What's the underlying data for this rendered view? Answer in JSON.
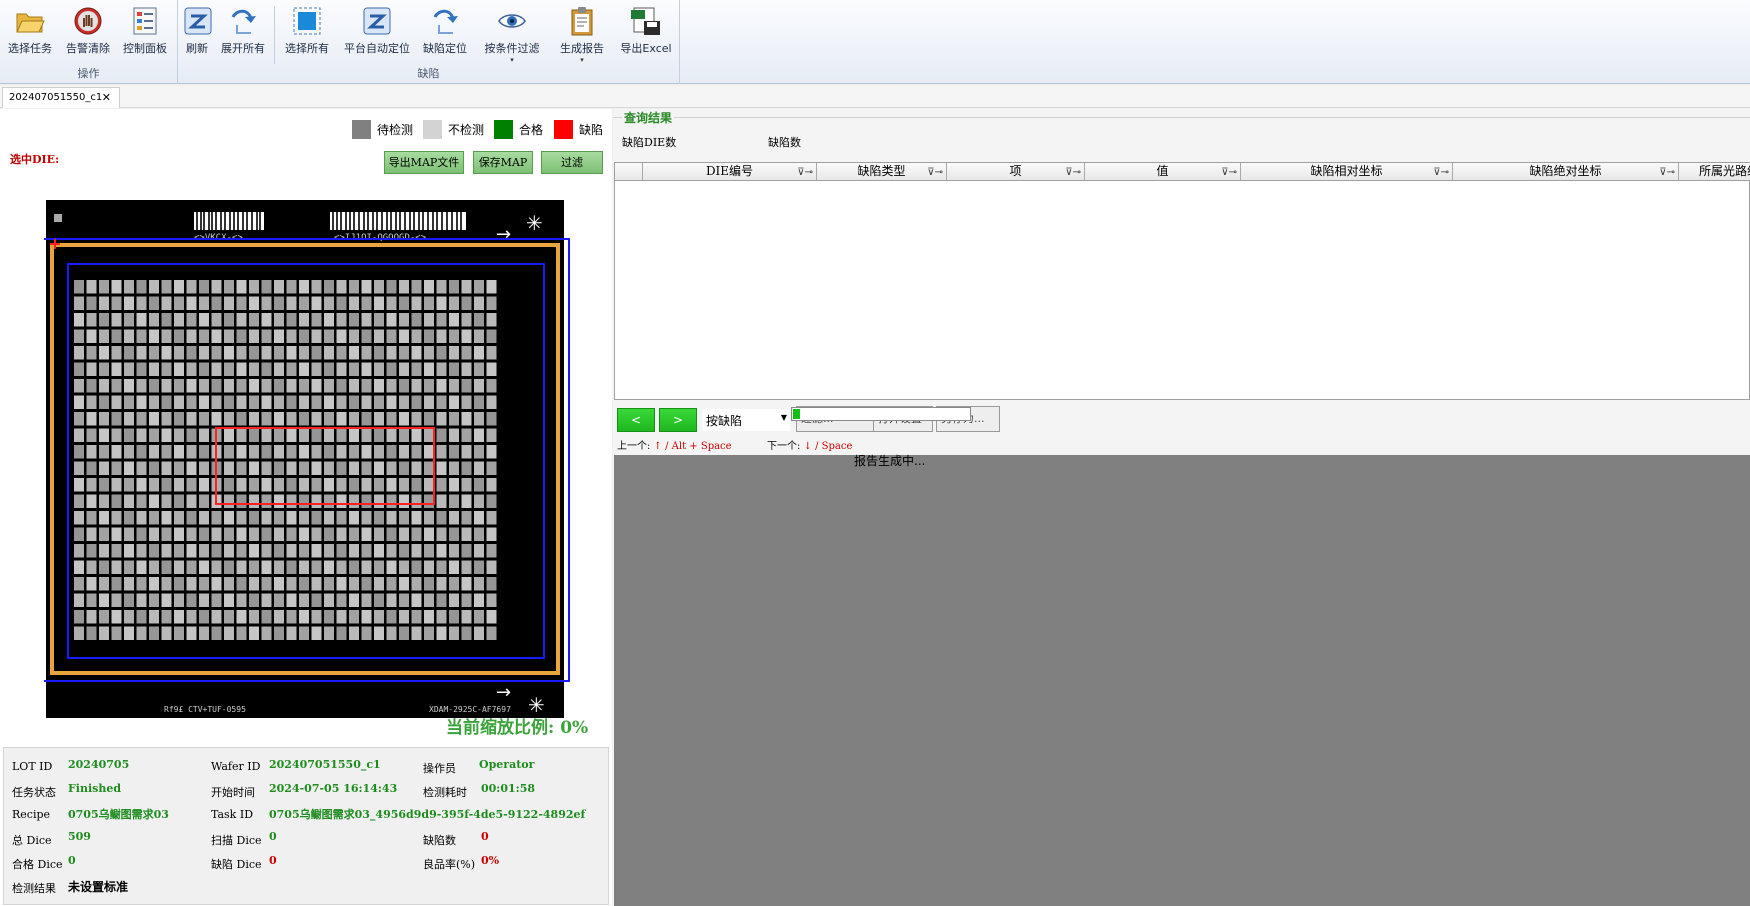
{
  "ribbon": {
    "groups": [
      {
        "label": "操作"
      },
      {
        "label": "缺陷"
      }
    ],
    "buttons": [
      {
        "label": "选择任务"
      },
      {
        "label": "告警清除"
      },
      {
        "label": "控制面板"
      },
      {
        "label": "刷新"
      },
      {
        "label": "展开所有"
      },
      {
        "label": "选择所有"
      },
      {
        "label": "平台自动定位"
      },
      {
        "label": "缺陷定位"
      },
      {
        "label": "按条件过滤",
        "dropdown": "▾"
      },
      {
        "label": "生成报告",
        "dropdown": "▾"
      },
      {
        "label": "导出Excel"
      }
    ]
  },
  "tab": {
    "title": "202407051550_c1",
    "close": "✕"
  },
  "legend": [
    {
      "label": "待检测",
      "color": "#808080"
    },
    {
      "label": "不检测",
      "color": "#d3d3d3"
    },
    {
      "label": "合格",
      "color": "#008000"
    },
    {
      "label": "缺陷",
      "color": "#ff0000"
    }
  ],
  "left": {
    "selected_die_label": "选中DIE:",
    "buttons": {
      "export_map": "导出MAP文件",
      "save_map": "保存MAP",
      "filter": "过滤"
    },
    "zoom_text": "当前缩放比例: 0%",
    "wafer": {
      "top_text_left": "<>VKCX-<>",
      "top_text_right": "<>IJ1OI-QGOOGD-<>",
      "bottom_text_left": "Rf9£ CTV+TUF-0595",
      "bottom_text_right": "XDAM-2925C-AF7697"
    }
  },
  "info": {
    "lot_id": {
      "label": "LOT ID",
      "value": "20240705"
    },
    "wafer_id": {
      "label": "Wafer ID",
      "value": "202407051550_c1"
    },
    "operator": {
      "label": "操作员",
      "value": "Operator"
    },
    "task_status": {
      "label": "任务状态",
      "value": "Finished"
    },
    "start_time": {
      "label": "开始时间",
      "value": "2024-07-05 16:14:43"
    },
    "duration": {
      "label": "检测耗时",
      "value": "00:01:58"
    },
    "recipe": {
      "label": "Recipe",
      "value": "0705乌鳚图需求03"
    },
    "task_id": {
      "label": "Task ID",
      "value": "0705乌鳚图需求03_4956d9d9-395f-4de5-9122-4892ef"
    },
    "total_dice": {
      "label": "总 Dice",
      "value": "509"
    },
    "scan_dice": {
      "label": "扫描 Dice",
      "value": "0"
    },
    "defect_count": {
      "label": "缺陷数",
      "value": "0"
    },
    "pass_dice": {
      "label": "合格 Dice",
      "value": "0"
    },
    "defect_dice": {
      "label": "缺陷 Dice",
      "value": "0"
    },
    "yield": {
      "label": "良品率(%)",
      "value": "0%"
    },
    "result": {
      "label": "检测结果",
      "value": "未设置标准"
    }
  },
  "right": {
    "query_title": "查询结果",
    "defect_die_count_label": "缺陷DIE数",
    "defect_count_label": "缺陷数",
    "columns": [
      "DIE编号",
      "缺陷类型",
      "项",
      "值",
      "缺陷相对坐标",
      "缺陷绝对坐标",
      "所属光路组"
    ],
    "prev_btn": "<",
    "next_btn": ">",
    "combo_value": "按缺陷",
    "hidden_btn1": "过滤...",
    "hidden_btn2": "打开设置",
    "hidden_btn3": "另存为...",
    "progress": 0.04,
    "hint_prev_label": "上一个:",
    "hint_prev_key": "↑ / Alt + Space",
    "hint_next_label": "下一个:",
    "hint_next_key": "↓ / Space",
    "report_status": "报告生成中..."
  }
}
